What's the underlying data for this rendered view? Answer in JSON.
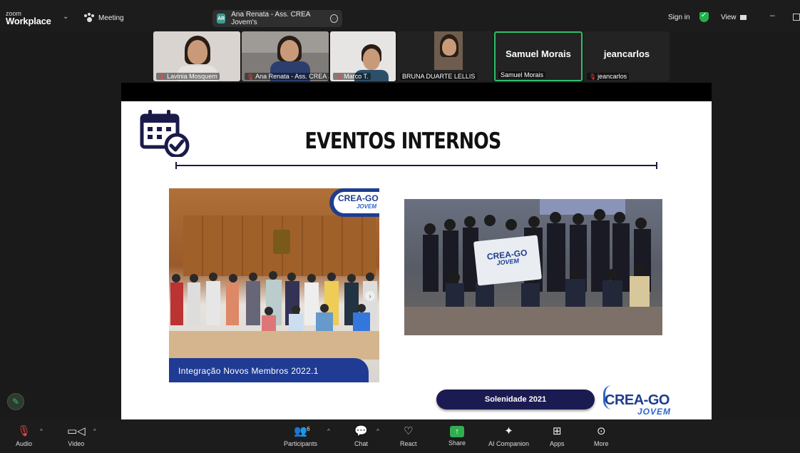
{
  "app": {
    "brand_top": "zoom",
    "brand_bottom": "Workplace",
    "meeting_label": "Meeting"
  },
  "speaker": {
    "initials": "AR",
    "name": "Ana Renata - Ass. CREA Jovem's"
  },
  "topright": {
    "signin": "Sign in",
    "view": "View",
    "minimize": "–"
  },
  "participants": [
    {
      "name": "Lavinia Mosquem",
      "muted": true
    },
    {
      "name": "Ana Renata - Ass. CREA Jo...",
      "muted": true
    },
    {
      "name": "Marco T.",
      "muted": true
    },
    {
      "name": "BRUNA DUARTE LELLIS",
      "muted": false
    },
    {
      "name": "Samuel Morais",
      "display": "Samuel Morais",
      "muted": false
    },
    {
      "name": "jeancarlos",
      "display": "jeancarlos",
      "muted": true
    }
  ],
  "slide": {
    "title": "EVENTOS INTERNOS",
    "photo1_caption": "Integração Novos Membros 2022.1",
    "logo_main": "CREA-GO",
    "logo_sub": "JOVEM",
    "banner_main": "CREA-GO",
    "banner_sub": "JOVEM",
    "photo2_button": "Solenidade 2021"
  },
  "toolbar": {
    "audio": "Audio",
    "video": "Video",
    "participants": "Participants",
    "participants_count": "6",
    "chat": "Chat",
    "react": "React",
    "share": "Share",
    "ai": "AI Companion",
    "apps": "Apps",
    "more": "More"
  },
  "colors": {
    "active_speaker": "#2fbf6a",
    "share_green": "#2fae52",
    "crea_blue": "#1e3d8f",
    "pill_navy": "#1b1b52"
  }
}
